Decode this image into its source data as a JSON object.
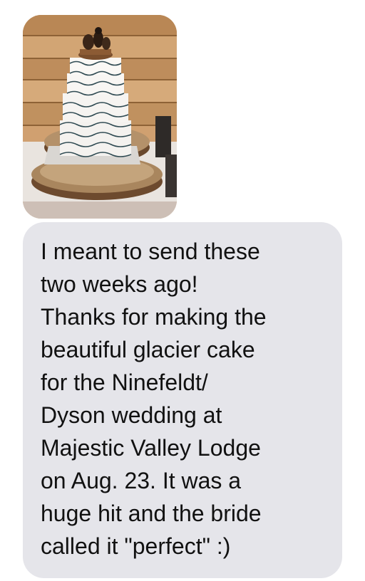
{
  "conversation": {
    "incoming_photo": {
      "subject": "white tiered glacier wedding cake on a log slice stand with pinecone cake topper"
    },
    "incoming_message": {
      "text": "I meant to send these\ntwo weeks ago!\nThanks for making the\nbeautiful glacier cake\nfor the Ninefeldt/\nDyson wedding at\nMajestic Valley Lodge\non Aug. 23. It was a\nhuge hit and the bride\ncalled it \"perfect\" :)"
    }
  },
  "colors": {
    "incoming_bubble": "#e5e5ea",
    "message_text": "#111111",
    "background": "#ffffff"
  }
}
